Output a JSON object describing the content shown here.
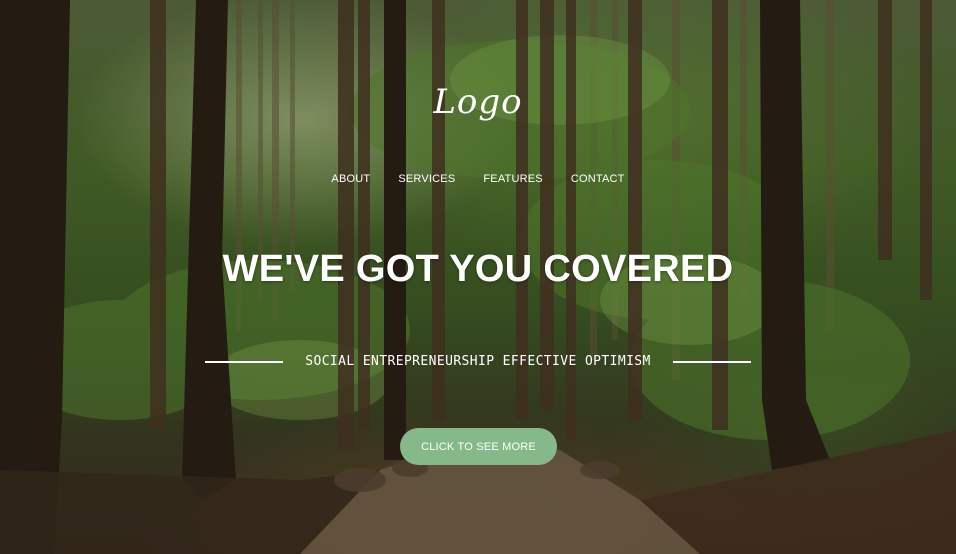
{
  "brand": {
    "logo_text": "Logo"
  },
  "nav": {
    "items": [
      {
        "label": "ABOUT"
      },
      {
        "label": "SERVICES"
      },
      {
        "label": "FEATURES"
      },
      {
        "label": "CONTACT"
      }
    ]
  },
  "hero": {
    "headline": "WE'VE GOT YOU COVERED",
    "tagline": "SOCIAL ENTREPRENEURSHIP EFFECTIVE OPTIMISM",
    "cta_label": "CLICK TO SEE MORE",
    "background": "forest-photo"
  },
  "colors": {
    "text": "#ffffff",
    "cta_background": "#86b98a"
  }
}
